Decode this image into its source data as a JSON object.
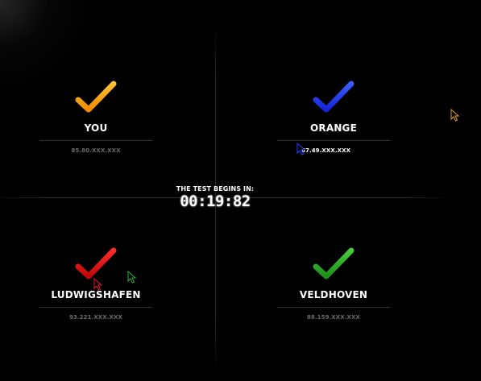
{
  "countdown": {
    "label": "THE TEST BEGINS IN:",
    "time": "00:19:82"
  },
  "players": [
    {
      "name": "YOU",
      "ip": "85.80.XXX.XXX",
      "check_color": "#f5a300",
      "icon": "checkmark-icon"
    },
    {
      "name": "ORANGE",
      "ip": "67.49.XXX.XXX",
      "check_color": "#1e3cf0",
      "icon": "checkmark-icon"
    },
    {
      "name": "LUDWIGSHAFEN",
      "ip": "93.221.XXX.XXX",
      "check_color": "#e01414",
      "icon": "checkmark-icon"
    },
    {
      "name": "VELDHOVEN",
      "ip": "88.159.XXX.XXX",
      "check_color": "#2fae28",
      "icon": "checkmark-icon"
    }
  ],
  "cursors": [
    {
      "owner": "orange",
      "color": "#2b3cff",
      "icon": "cursor-icon"
    },
    {
      "owner": "you",
      "color": "#e0a020",
      "icon": "cursor-icon"
    },
    {
      "owner": "ludwigshafen",
      "color": "#e02020",
      "icon": "cursor-icon"
    },
    {
      "owner": "veldhoven",
      "color": "#30b030",
      "icon": "cursor-icon"
    }
  ]
}
